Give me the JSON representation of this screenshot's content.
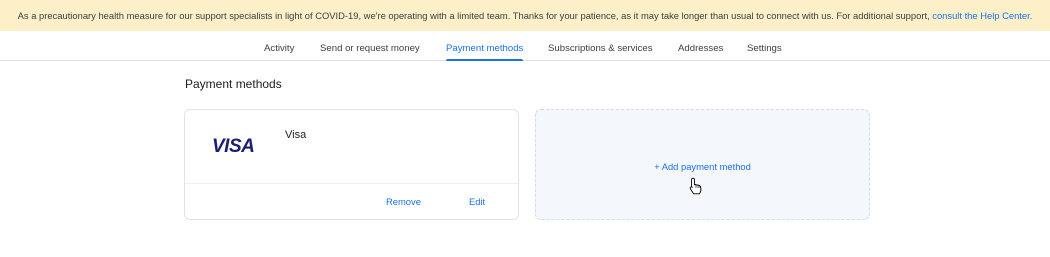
{
  "banner": {
    "text": "As a precautionary health measure for our support specialists in light of COVID-19, we're operating with a limited team. Thanks for your patience, as it may take longer than usual to connect with us. For additional support, ",
    "link": "consult the Help Center."
  },
  "tabs": [
    {
      "label": "Activity"
    },
    {
      "label": "Send or request money"
    },
    {
      "label": "Payment methods",
      "active": true
    },
    {
      "label": "Subscriptions & services"
    },
    {
      "label": "Addresses"
    },
    {
      "label": "Settings"
    }
  ],
  "section_title": "Payment methods",
  "card": {
    "logo": "VISA",
    "name": "Visa",
    "remove_label": "Remove",
    "edit_label": "Edit"
  },
  "add_method": {
    "label": "+ Add payment method"
  },
  "colors": {
    "accent": "#1a73e8",
    "banner_bg": "#fdefc8",
    "visa_blue": "#1a1f71"
  },
  "cursor": "hand-pointer-icon"
}
